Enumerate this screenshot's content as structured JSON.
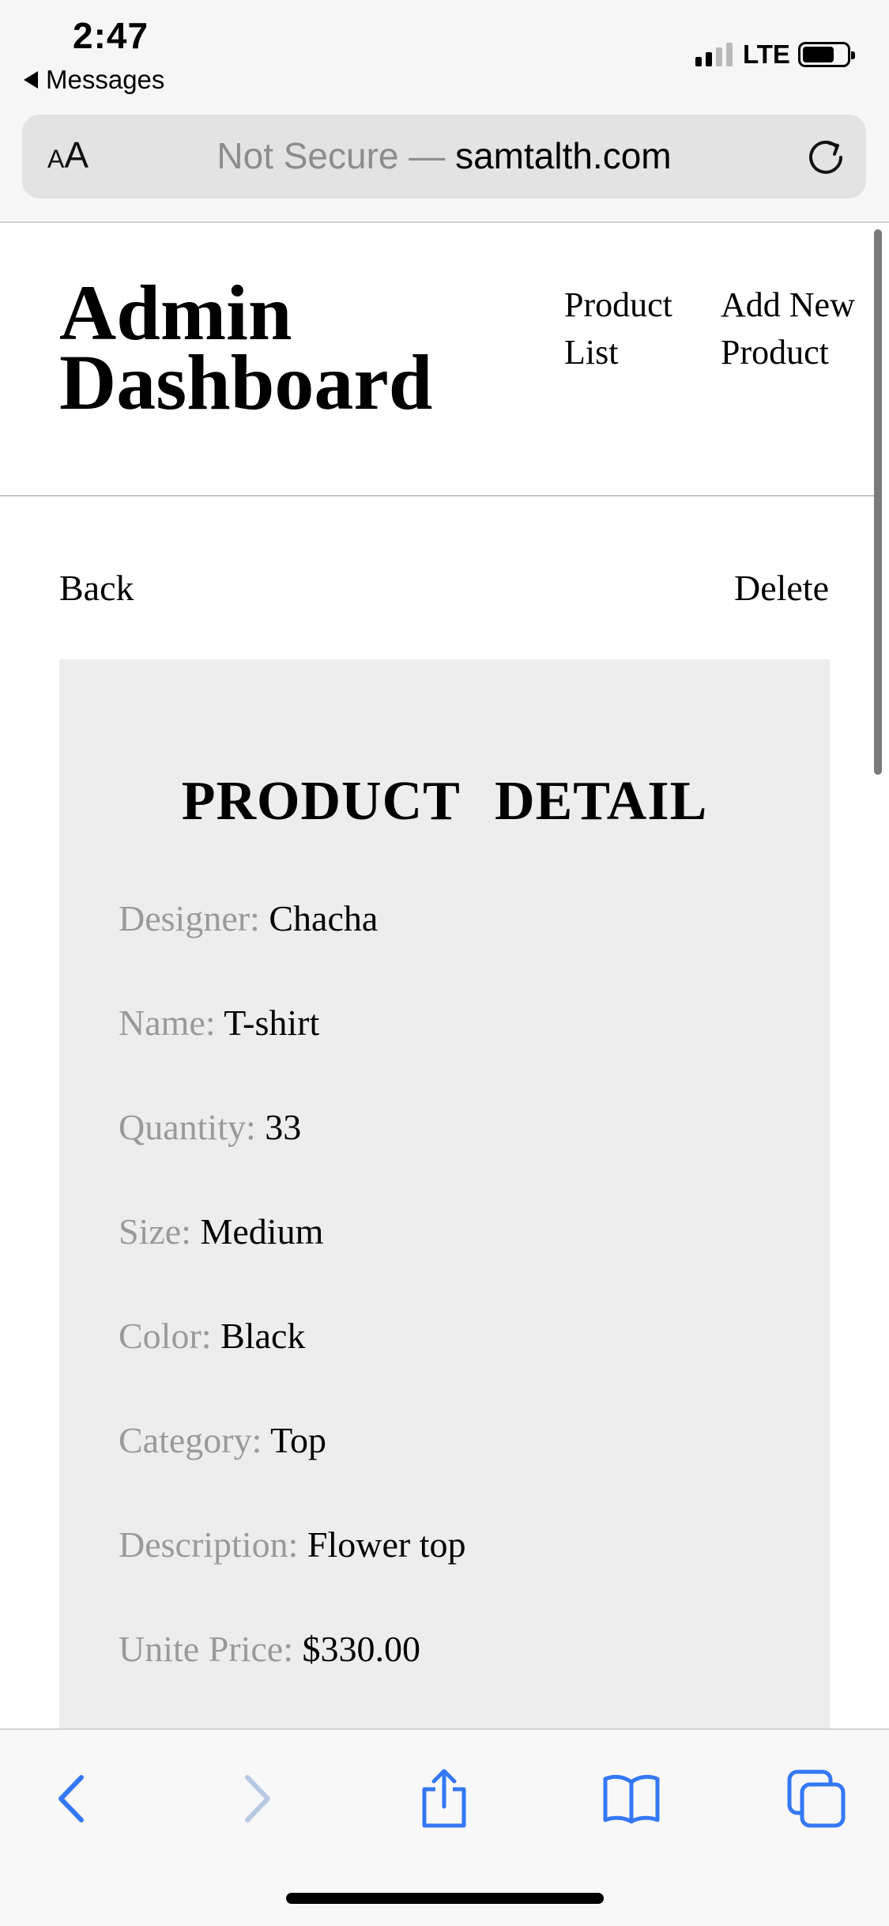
{
  "status_bar": {
    "time": "2:47",
    "back_app": "Messages",
    "network": "LTE",
    "signal_bars_active": 2,
    "signal_bars_total": 4,
    "battery_level": 0.72
  },
  "browser": {
    "aa_small": "A",
    "aa_large": "A",
    "security": "Not Secure",
    "separator": " — ",
    "host": "samtalth.com",
    "reload_icon": "reload-icon"
  },
  "header": {
    "title_line1": "Admin",
    "title_line2": "Dashboard",
    "nav": {
      "product_list": "Product List",
      "add_new_product": "Add New Product"
    }
  },
  "actions": {
    "back": "Back",
    "delete": "Delete"
  },
  "detail": {
    "heading": "PRODUCT DETAIL",
    "fields": [
      {
        "label": "Designer:",
        "value": "Chacha"
      },
      {
        "label": "Name:",
        "value": "T-shirt"
      },
      {
        "label": "Quantity:",
        "value": "33"
      },
      {
        "label": "Size:",
        "value": "Medium"
      },
      {
        "label": "Color:",
        "value": "Black"
      },
      {
        "label": "Category:",
        "value": "Top"
      },
      {
        "label": "Description:",
        "value": "Flower top"
      },
      {
        "label": "Unite Price:",
        "value": "$330.00"
      }
    ]
  },
  "toolbar": {
    "icons": [
      "back-chevron-icon",
      "forward-chevron-icon",
      "share-icon",
      "bookmarks-icon",
      "tabs-icon"
    ],
    "accent_color": "#3478f6",
    "disabled_color": "#b8c9e6"
  },
  "colors": {
    "card_background": "#ededed",
    "field_label": "#9a9a9a",
    "chrome_background": "#f6f6f6"
  }
}
